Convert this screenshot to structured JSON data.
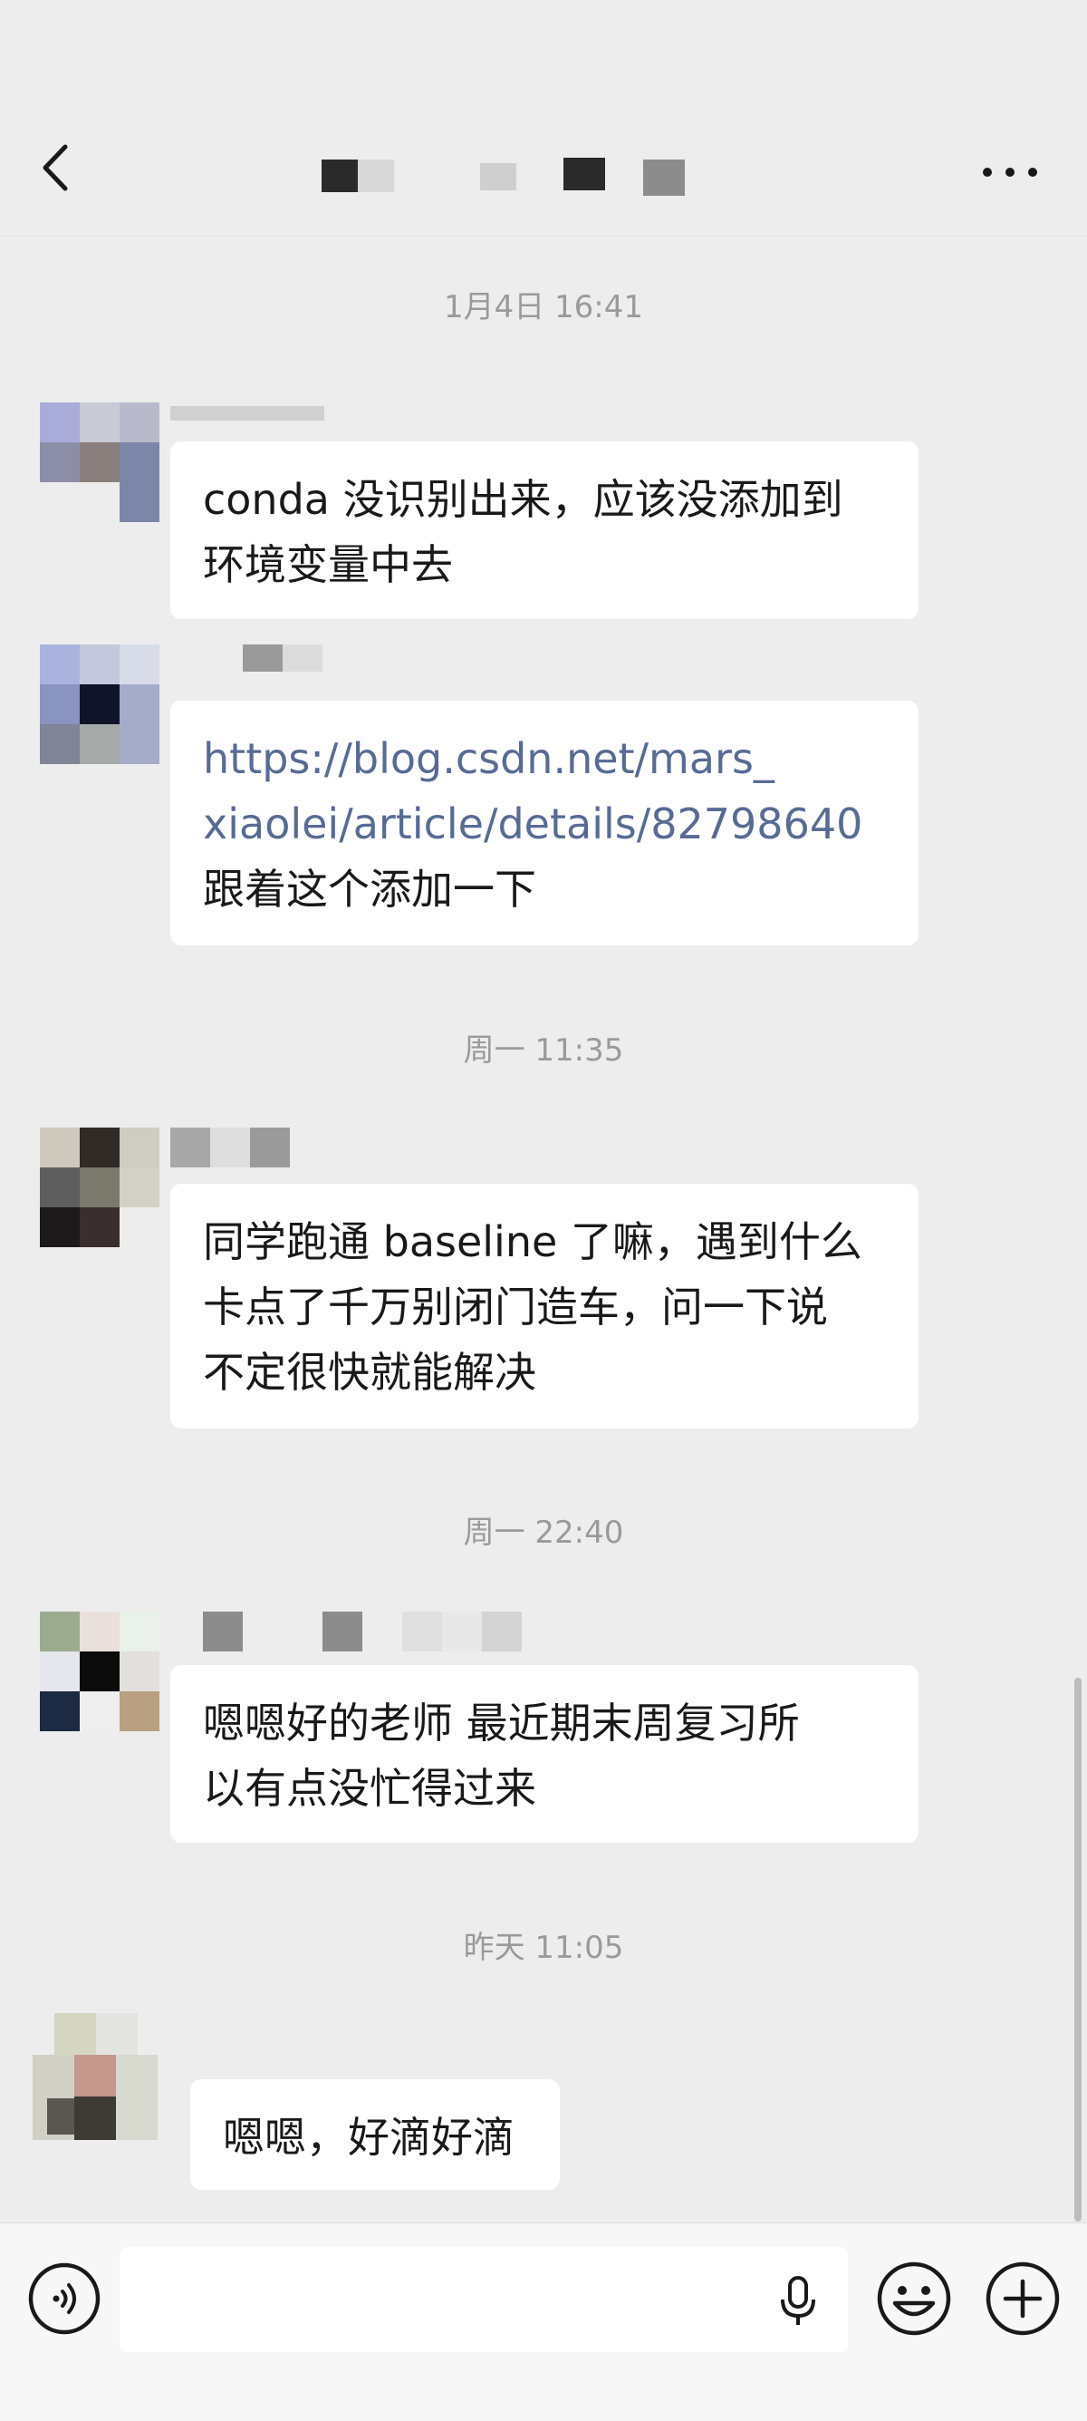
{
  "header": {
    "title": "",
    "back_icon": "chevron-left-icon",
    "more_icon": "more-dots-icon"
  },
  "messages": [
    {
      "time": "1月4日 16:41",
      "lines": [
        "conda 没识别出来，应该没添加到",
        "环境变量中去"
      ]
    },
    {
      "link_lines": [
        "https://blog.csdn.net/mars_",
        "xiaolei/article/details/82798640"
      ],
      "lines": [
        "跟着这个添加一下"
      ]
    },
    {
      "time": "周一 11:35",
      "lines": [
        "同学跑通 baseline 了嘛，遇到什么",
        "卡点了千万别闭门造车，问一下说",
        "不定很快就能解决"
      ]
    },
    {
      "time": "周一 22:40",
      "lines": [
        "嗯嗯好的老师 最近期末周复习所",
        "以有点没忙得过来"
      ]
    },
    {
      "time": "昨天 11:05",
      "lines": [
        "嗯嗯，好滴好滴"
      ]
    }
  ],
  "input": {
    "value": "",
    "placeholder": ""
  },
  "icons": {
    "voice": "voice-icon",
    "mic": "microphone-icon",
    "emoji": "emoji-icon",
    "plus": "plus-circle-icon"
  },
  "colors": {
    "background": "#ededed",
    "bubble": "#ffffff",
    "link": "#576b95",
    "timestamp": "#9a9a9a"
  }
}
